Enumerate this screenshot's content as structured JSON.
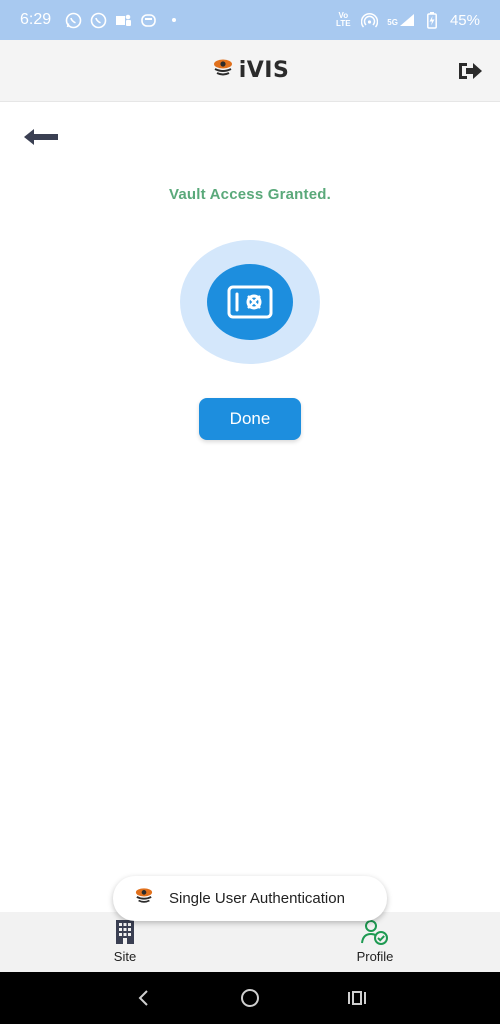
{
  "status_bar": {
    "time": "6:29",
    "network_top": "Vo LTE",
    "network_gen": "5G",
    "battery": "45%"
  },
  "header": {
    "brand": "iVIS",
    "logout_icon": "logout-icon"
  },
  "main": {
    "message": "Vault Access Granted.",
    "done_label": "Done"
  },
  "toast": {
    "text": "Single User Authentication"
  },
  "bottom_nav": {
    "items": [
      {
        "label": "Site",
        "icon": "building-icon"
      },
      {
        "label": "Profile",
        "icon": "user-check-icon"
      }
    ]
  },
  "colors": {
    "accent": "#1d8ede",
    "success": "#5aa97a",
    "status_bar": "#a8c9f0"
  }
}
